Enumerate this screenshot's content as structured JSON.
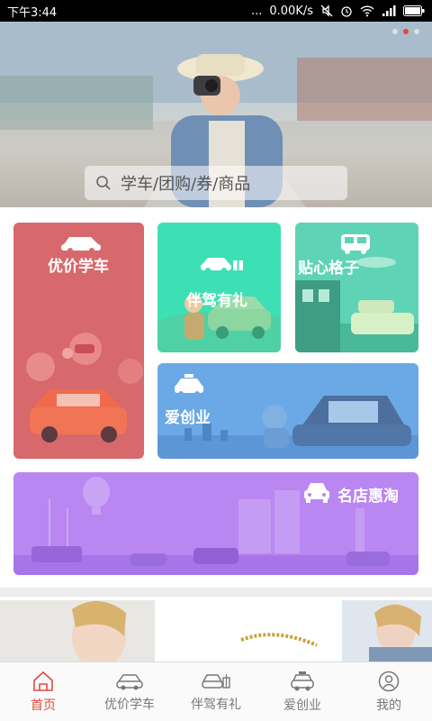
{
  "status_bar": {
    "time": "下午3:44",
    "network_speed": "0.00K/s",
    "signal": "...",
    "icons": [
      "mute-icon",
      "alarm-icon",
      "wifi-icon",
      "signal-icon",
      "battery-icon"
    ]
  },
  "banner": {
    "slides": 3,
    "active_slide": 1,
    "search_placeholder": "学车/团购/券/商品",
    "icons": [
      "search-icon"
    ]
  },
  "tiles": {
    "price_driving": {
      "label": "优价学车",
      "icon": "car-icon",
      "color": "#d7686b"
    },
    "companion_gift": {
      "label": "伴驾有礼",
      "icon": "car-gift-icon",
      "color": "#3de0b4"
    },
    "caring_grid": {
      "label": "贴心格子",
      "icon": "bus-icon",
      "color": "#5fd3b5"
    },
    "love_business": {
      "label": "爱创业",
      "icon": "taxi-icon",
      "color": "#6aa9e6"
    },
    "famous_shops": {
      "label": "名店惠淘",
      "icon": "car-front-icon",
      "color": "#b986f2"
    }
  },
  "tabbar": {
    "items": [
      {
        "label": "首页",
        "icon": "home-icon",
        "active": true
      },
      {
        "label": "优价学车",
        "icon": "car-icon",
        "active": false
      },
      {
        "label": "伴驾有礼",
        "icon": "car-gift-icon",
        "active": false
      },
      {
        "label": "爱创业",
        "icon": "taxi-icon",
        "active": false
      },
      {
        "label": "我的",
        "icon": "user-icon",
        "active": false
      }
    ]
  },
  "colors": {
    "accent": "#e0493f",
    "status_bar": "#000000"
  }
}
